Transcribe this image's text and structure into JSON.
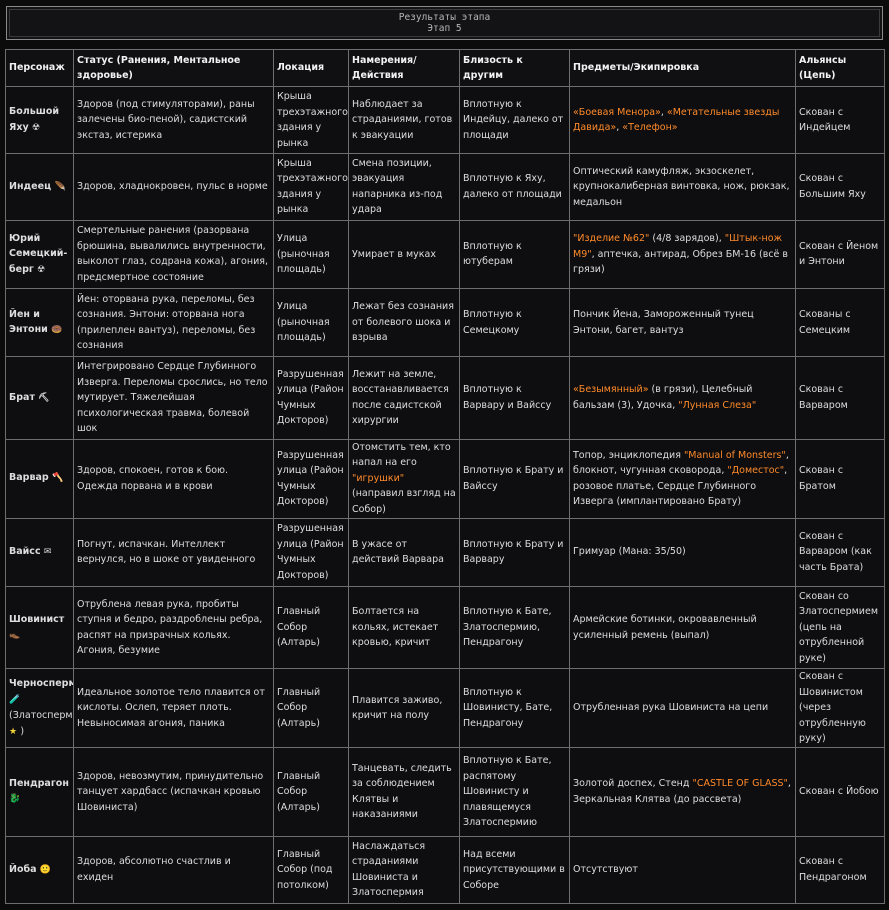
{
  "header": {
    "title": "Результаты этапа",
    "subtitle": "Этап 5"
  },
  "table": {
    "columns": [
      "Персонаж",
      "Статус (Ранения, Ментальное здоровье)",
      "Локация",
      "Намерения/Действия",
      "Близость к другим",
      "Предметы/Экипировка",
      "Альянсы (Цепь)"
    ],
    "rows": [
      {
        "name": "Большой Яху",
        "icon": "☢",
        "status": "Здоров (под стимуляторами), раны залечены био-пеной), садистский экстаз, истерика",
        "location": "Крыша трехэтажного здания у рынка",
        "actions": "Наблюдает за страданиями, готов к эвакуации",
        "proximity": "Вплотную к Индейцу, далеко от площади",
        "items": [
          {
            "t": "«Боевая Менора»",
            "hl": true
          },
          {
            "t": ", ",
            "hl": false
          },
          {
            "t": "«Метательные звезды Давида»",
            "hl": true
          },
          {
            "t": ", ",
            "hl": false
          },
          {
            "t": "«Телефон»",
            "hl": true
          }
        ],
        "alliance": "Скован с Индейцем"
      },
      {
        "name": "Индеец",
        "icon": "🪶",
        "status": "Здоров, хладнокровен, пульс в норме",
        "location": "Крыша трехэтажного здания у рынка",
        "actions": "Смена позиции, эвакуация напарника из-под удара",
        "proximity": "Вплотную к Яху, далеко от площади",
        "items": [
          {
            "t": "Оптический камуфляж, экзоскелет, крупнокалиберная винтовка, нож, рюкзак, медальон",
            "hl": false
          }
        ],
        "alliance": "Скован с Большим Яху"
      },
      {
        "name": "Юрий Семецкий-берг",
        "icon": "☢",
        "status": "Смертельные ранения (разорвана брюшина, вывалились внутренности, выколот глаз, содрана кожа), агония, предсмертное состояние",
        "location": "Улица (рыночная площадь)",
        "actions": "Умирает в муках",
        "proximity": "Вплотную к ютуберам",
        "items": [
          {
            "t": "\"Изделие №62\"",
            "hl": true
          },
          {
            "t": " (4/8 зарядов), ",
            "hl": false
          },
          {
            "t": "\"Штык-нож М9\"",
            "hl": true
          },
          {
            "t": ", аптечка, антирад, Обрез БМ-16 (всё в грязи)",
            "hl": false
          }
        ],
        "alliance": "Скован с Йеном и Энтони"
      },
      {
        "name": "Йен и Энтони",
        "icon": "🍩",
        "status": "Йен: оторвана рука, переломы, без сознания. Энтони: оторвана нога (прилеплен вантуз), переломы, без сознания",
        "location": "Улица (рыночная площадь)",
        "actions": "Лежат без сознания от болевого шока и взрыва",
        "proximity": "Вплотную к Семецкому",
        "items": [
          {
            "t": "Пончик Йена, Замороженный тунец Энтони, багет, вантуз",
            "hl": false
          }
        ],
        "alliance": "Скованы с Семецким"
      },
      {
        "name": "Брат",
        "icon": "⛏",
        "status": "Интегрировано Сердце Глубинного Изверга. Переломы срослись, но тело мутирует. Тяжелейшая психологическая травма, болевой шок",
        "location": "Разрушенная улица (Район Чумных Докторов)",
        "actions": "Лежит на земле, восстанавливается после садистской хирургии",
        "proximity": "Вплотную к Варвару и Вайссу",
        "items": [
          {
            "t": "«Безымянный»",
            "hl": true
          },
          {
            "t": " (в грязи), Целебный бальзам (3), Удочка, ",
            "hl": false
          },
          {
            "t": "\"Лунная Слеза\"",
            "hl": true
          }
        ],
        "alliance": "Скован с Варваром"
      },
      {
        "name": "Варвар",
        "icon": "🪓",
        "status": "Здоров, спокоен, готов к бою. Одежда порвана и в крови",
        "location": "Разрушенная улица (Район Чумных Докторов)",
        "actions_parts": [
          {
            "t": "Отомстить тем, кто напал на его ",
            "hl": false
          },
          {
            "t": "\"игрушки\"",
            "hl": true
          },
          {
            "t": " (направил взгляд на Собор)",
            "hl": false
          }
        ],
        "proximity": "Вплотную к Брату и Вайссу",
        "items": [
          {
            "t": "Топор, энциклопедия ",
            "hl": false
          },
          {
            "t": "\"Manual of Monsters\"",
            "hl": true
          },
          {
            "t": ", блокнот, чугунная сковорода, ",
            "hl": false
          },
          {
            "t": "\"Доместос\"",
            "hl": true
          },
          {
            "t": ", розовое платье, Сердце Глубинного Изверга (имплантировано Брату)",
            "hl": false
          }
        ],
        "alliance": "Скован с Братом"
      },
      {
        "name": "Вайсс",
        "icon": "✉",
        "status": "Погнут, испачкан. Интеллект вернулся, но в шоке от увиденного",
        "location": "Разрушенная улица (Район Чумных Докторов)",
        "actions": "В ужасе от действий Варвара",
        "proximity": "Вплотную к Брату и Варвару",
        "items": [
          {
            "t": "Гримуар (Мана: 35/50)",
            "hl": false
          }
        ],
        "alliance": "Скован с Варваром (как часть Брата)"
      },
      {
        "name": "Шовинист",
        "icon": "👞",
        "status": "Отрублена левая рука, пробиты ступня и бедро, раздроблены ребра, распят на призрачных кольях. Агония, безумие",
        "location": "Главный Собор (Алтарь)",
        "actions": "Болтается на кольях, истекает кровью, кричит",
        "proximity": "Вплотную к Бате, Златоспермию, Пендрагону",
        "items": [
          {
            "t": "Армейские ботинки, окровавленный усиленный ремень (выпал)",
            "hl": false
          }
        ],
        "alliance": "Скован со Златоспермием (цепь на отрубленной руке)"
      },
      {
        "name": "Черноспермий",
        "icon": "🧪",
        "name_extra": "(Златоспермий",
        "icon2": "★",
        "name_close": ")",
        "status": "Идеальное золотое тело плавится от кислоты. Ослеп, теряет плоть. Невыносимая агония, паника",
        "location": "Главный Собор (Алтарь)",
        "actions": "Плавится заживо, кричит на полу",
        "proximity": "Вплотную к Шовинисту, Бате, Пендрагону",
        "items": [
          {
            "t": "Отрубленная рука Шовиниста на цепи",
            "hl": false
          }
        ],
        "alliance": "Скован с Шовинистом (через отрубленную руку)"
      },
      {
        "name": "Пендрагон",
        "icon": "🐉",
        "status": "Здоров, невозмутим, принудительно танцует хардбасс (испачкан кровью Шовиниста)",
        "location": "Главный Собор (Алтарь)",
        "actions": "Танцевать, следить за соблюдением Клятвы и наказаниями",
        "proximity": "Вплотную к Бате, распятому Шовинисту и плавящемуся Златоспермию",
        "items": [
          {
            "t": "Золотой доспех, Стенд ",
            "hl": false
          },
          {
            "t": "\"CASTLE OF GLASS\"",
            "hl": true
          },
          {
            "t": ", Зеркальная Клятва (до рассвета)",
            "hl": false
          }
        ],
        "alliance": "Скован с Йобою"
      },
      {
        "name": "Йоба",
        "icon": "🙂",
        "status": "Здоров, абсолютно счастлив и ехиден",
        "location": "Главный Собор (под потолком)",
        "actions": "Наслаждаться страданиями Шовиниста и Златоспермия",
        "proximity": "Над всеми присутствующими в Соборе",
        "items": [
          {
            "t": "Отсутствуют",
            "hl": false
          }
        ],
        "alliance": "Скован с Пендрагоном"
      }
    ]
  }
}
